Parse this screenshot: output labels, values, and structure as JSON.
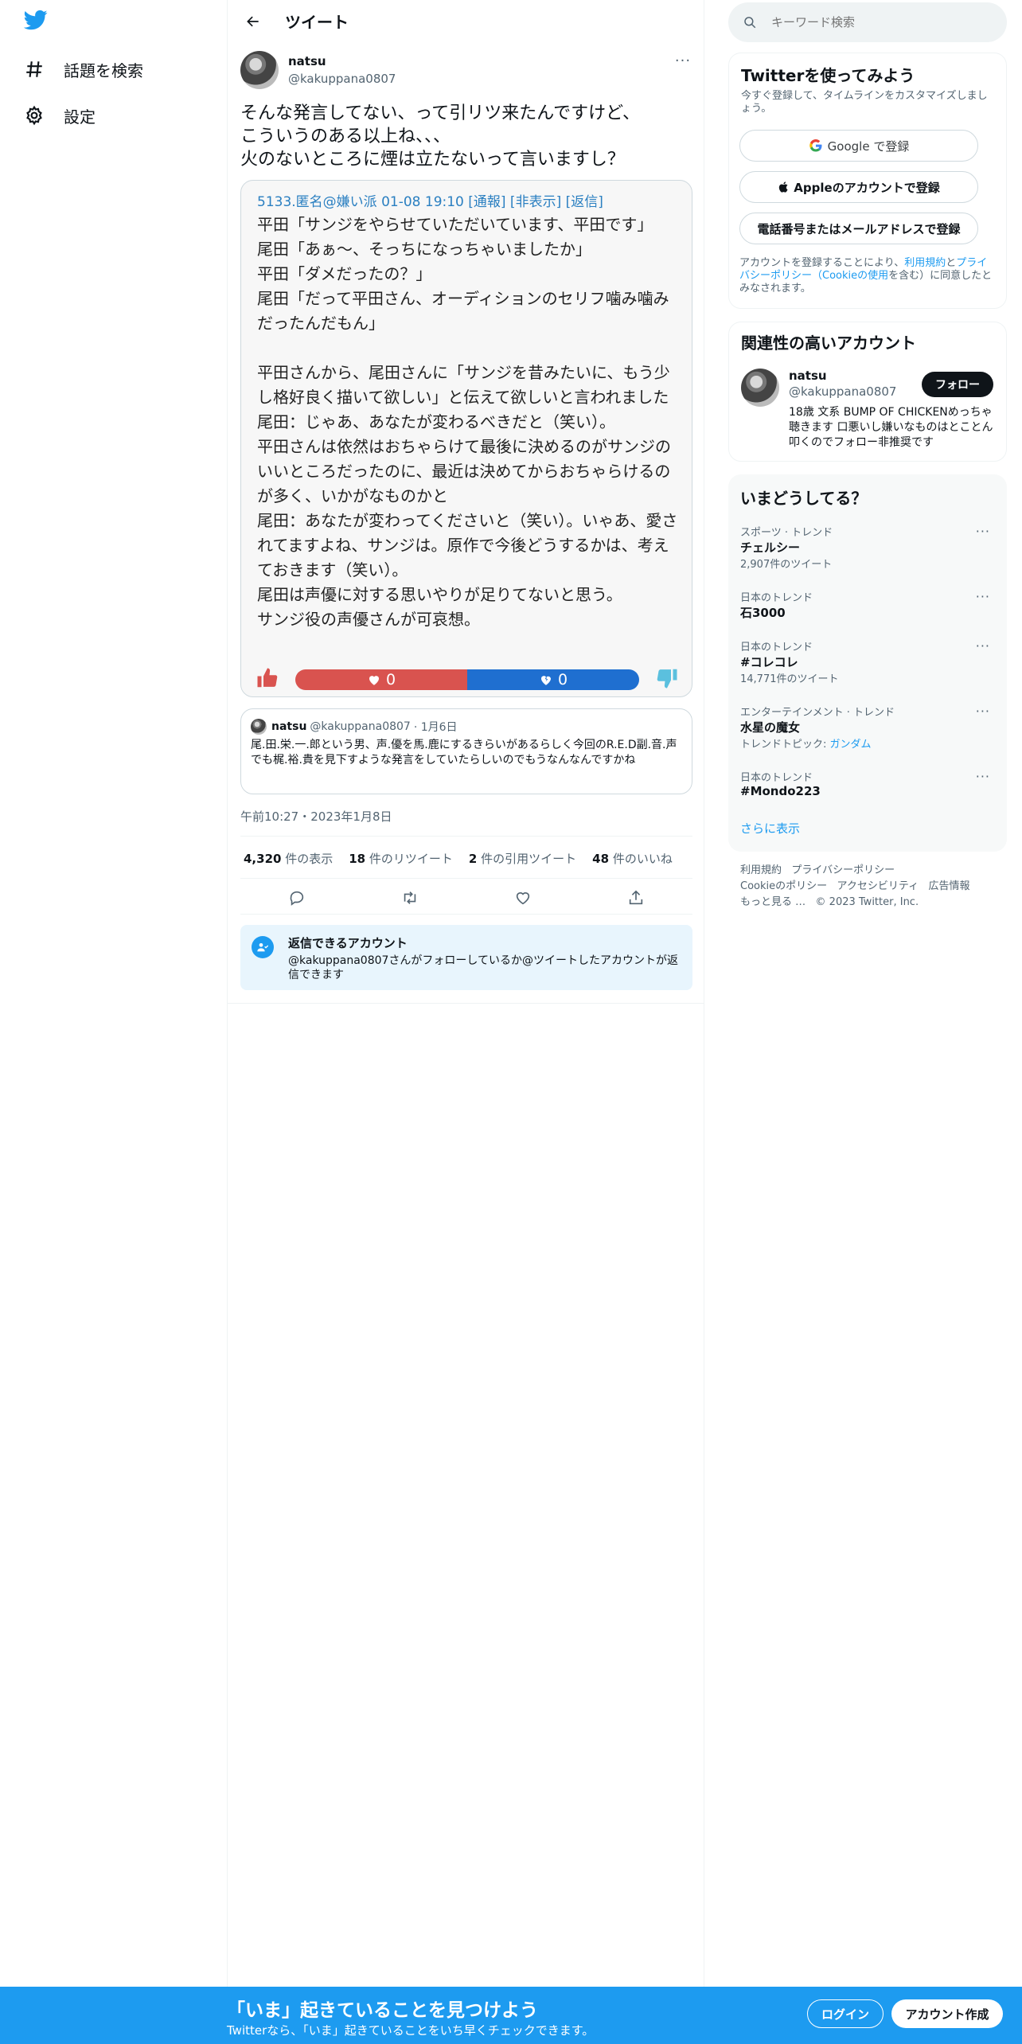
{
  "nav": {
    "items": [
      {
        "label": "話題を検索",
        "icon": "hashtag-icon"
      },
      {
        "label": "設定",
        "icon": "gear-icon"
      }
    ]
  },
  "header": {
    "title": "ツイート"
  },
  "tweet": {
    "author_name": "natsu",
    "author_handle": "@kakuppana0807",
    "text": "そんな発言してない、って引リツ来たんですけど、\nこういうのある以上ね、、、\n火のないところに煙は立たないって言いますし？",
    "quote_header": "5133.匿名@嫌い派 01-08 19:10 [通報] [非表示] [返信]",
    "quote_body": "平田「サンジをやらせていただいています、平田です」\n尾田「あぁ〜、そっちになっちゃいましたか」\n平田「ダメだったの？」\n尾田「だって平田さん、オーディションのセリフ噛み噛みだったんだもん」\n\n平田さんから、尾田さんに「サンジを昔みたいに、もう少し格好良く描いて欲しい」と伝えて欲しいと言われました\n尾田：じゃあ、あなたが変わるべきだと（笑い）。\n平田さんは依然はおちゃらけて最後に決めるのがサンジのいいところだったのに、最近は決めてからおちゃらけるのが多く、いかがなものかと\n尾田：あなたが変わってくださいと（笑い）。いゃあ、愛されてますよね、サンジは。原作で今後どうするかは、考えておきます（笑い）。\n尾田は声優に対する思いやりが足りてないと思う。\nサンジ役の声優さんが可哀想。",
    "vote_like": "0",
    "vote_dislike": "0",
    "quoted": {
      "name": "natsu",
      "handle": "@kakuppana0807",
      "date": "· 1月6日",
      "text": "尾.田.栄.一.郎という男、声.優を馬.鹿にするきらいがあるらしく今回のR.E.D副.音.声でも梶.裕.貴を見下すような発言をしていたらしいのでもうなんなんですかね"
    },
    "timestamp": "午前10:27・2023年1月8日",
    "stats": [
      {
        "num": "4,320",
        "label": "件の表示"
      },
      {
        "num": "18",
        "label": "件のリツイート"
      },
      {
        "num": "2",
        "label": "件の引用ツイート"
      },
      {
        "num": "48",
        "label": "件のいいね"
      }
    ],
    "reply_title": "返信できるアカウント",
    "reply_desc": "@kakuppana0807さんがフォローしているか@ツイートしたアカウントが返信できます"
  },
  "sidebar": {
    "search_placeholder": "キーワード検索",
    "signup": {
      "title": "Twitterを使ってみよう",
      "subtitle": "今すぐ登録して、タイムラインをカスタマイズしましょう。",
      "google": "Google で登録",
      "apple": "Appleのアカウントで登録",
      "phone": "電話番号またはメールアドレスで登録",
      "terms_a": "アカウントを登録することにより、",
      "terms_link1": "利用規約",
      "terms_b": "と",
      "terms_link2": "プライバシーポリシー（Cookieの使用",
      "terms_c": "を含む）に同意したとみなされます。"
    },
    "related": {
      "title": "関連性の高いアカウント",
      "name": "natsu",
      "handle": "@kakuppana0807",
      "follow": "フォロー",
      "bio": "18歳 文系 BUMP OF CHICKENめっちゃ聴きます 口悪いし嫌いなものはとことん叩くのでフォロー非推奨です"
    },
    "trends": {
      "title": "いまどうしてる？",
      "items": [
        {
          "meta": "スポーツ · トレンド",
          "name": "チェルシー",
          "count": "2,907件のツイート"
        },
        {
          "meta": "日本のトレンド",
          "name": "石3000",
          "count": ""
        },
        {
          "meta": "日本のトレンド",
          "name": "#コレコレ",
          "count": "14,771件のツイート"
        },
        {
          "meta": "エンターテインメント · トレンド",
          "name": "水星の魔女",
          "count": "トレンドトピック: ",
          "topic": "ガンダム"
        },
        {
          "meta": "日本のトレンド",
          "name": "#Mondo223",
          "count": ""
        }
      ],
      "more": "さらに表示"
    },
    "footer": {
      "line1": [
        "利用規約",
        "プライバシーポリシー"
      ],
      "line2": [
        "Cookieのポリシー",
        "アクセシビリティ",
        "広告情報"
      ],
      "line3_more": "もっと見る …",
      "copyright": "© 2023 Twitter, Inc."
    }
  },
  "bottom": {
    "title": "「いま」起きていることを見つけよう",
    "subtitle": "Twitterなら、「いま」起きていることをいち早くチェックできます。",
    "login": "ログイン",
    "signup": "アカウント作成"
  },
  "colors": {
    "brand": "#1d9bf0",
    "like": "#d9534f",
    "dislike": "#1f6fd0"
  }
}
